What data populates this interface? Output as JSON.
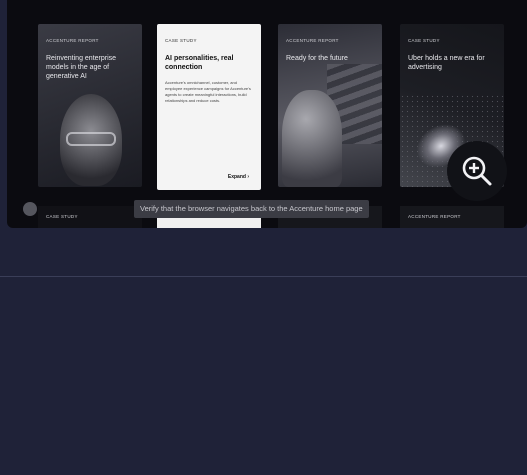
{
  "cards": [
    {
      "eyebrow": "Accenture Report",
      "title": "Reinventing enterprise models in the age of generative AI"
    },
    {
      "eyebrow": "Case Study",
      "title": "AI personalities, real connection",
      "body": "Accenture's omnichannel, customer, and employee experience campaigns for Accenture's agents to create meaningful interactions, build relationships and reduce costs.",
      "cta": "Expand"
    },
    {
      "eyebrow": "Accenture Report",
      "title": "Ready for the future"
    },
    {
      "eyebrow": "Case Study",
      "title": "Uber holds a new era for advertising"
    }
  ],
  "strip_labels": [
    "Case Study",
    "",
    "",
    "Accenture Report"
  ],
  "zoom": {
    "icon": "zoom-in-icon"
  },
  "tooltip": "Verify that the browser navigates back to the Accenture home page",
  "colors": {
    "background": "#1f2238",
    "frame": "#0b0b10",
    "tooltip_bg": "#3b3c44"
  }
}
